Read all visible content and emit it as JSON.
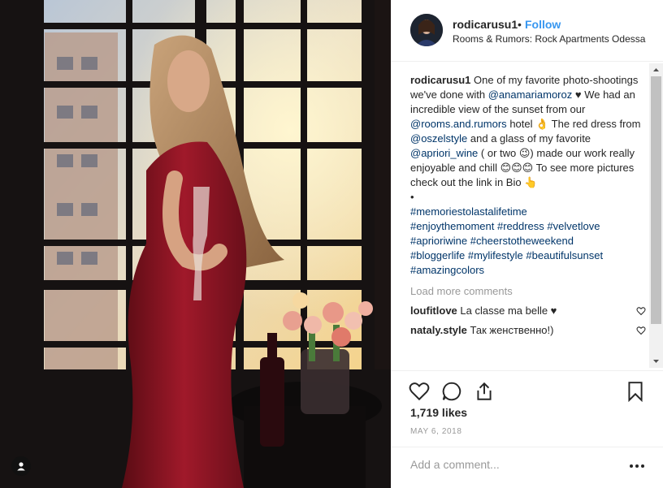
{
  "header": {
    "username": "rodicarusu1",
    "separator": "•",
    "follow": "Follow",
    "location": "Rooms & Rumors: Rock Apartments Odessa"
  },
  "caption": {
    "username": "rodicarusu1",
    "text1": "One of my favorite photo-shootings we've done with",
    "mention1": "@anamariamoroz",
    "text2": "♥ We had an incredible view of the sunset from our",
    "mention2": "@rooms.and.rumors",
    "text3": "hotel 👌 The red dress from",
    "mention3": "@oszelstyle",
    "text4": "and a glass of my favorite",
    "mention4": "@apriori_wine",
    "text5": "( or two 😉) made our work really enjoyable and chill 😊😊😊 To see more pictures check out the link in Bio 👆",
    "bullet": "•",
    "hashtags": [
      "#memoriestolastalifetime",
      "#enjoythemoment",
      "#reddress",
      "#velvetlove",
      "#aprioriwine",
      "#cheerstotheweekend",
      "#bloggerlife",
      "#mylifestyle",
      "#beautifulsunset",
      "#amazingcolors"
    ]
  },
  "load_more": "Load more comments",
  "comments": [
    {
      "username": "loufitlove",
      "text": "La classe ma belle ♥"
    },
    {
      "username": "nataly.style",
      "text": "Так женственно!)"
    }
  ],
  "likes": "1,719 likes",
  "date": "MAY 6, 2018",
  "add_comment_placeholder": "Add a comment...",
  "icons": [
    "user-tag-icon",
    "heart-icon",
    "comment-icon",
    "share-icon",
    "bookmark-icon",
    "more-options-icon",
    "heart-small-icon"
  ],
  "colors": {
    "link": "#003569",
    "follow": "#3897f0",
    "muted": "#999999",
    "text": "#262626"
  }
}
